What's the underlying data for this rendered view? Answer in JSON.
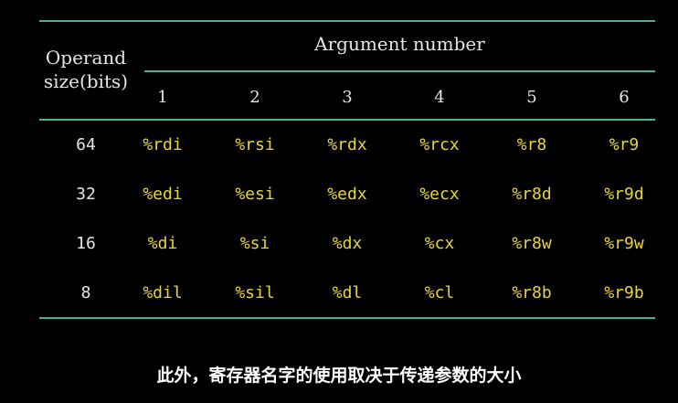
{
  "table": {
    "operand_header_line1": "Operand",
    "operand_header_line2": "size(bits)",
    "argument_header": "Argument number",
    "columns": [
      "1",
      "2",
      "3",
      "4",
      "5",
      "6"
    ],
    "rows": [
      {
        "size": "64",
        "regs": [
          "%rdi",
          "%rsi",
          "%rdx",
          "%rcx",
          "%r8",
          "%r9"
        ]
      },
      {
        "size": "32",
        "regs": [
          "%edi",
          "%esi",
          "%edx",
          "%ecx",
          "%r8d",
          "%r9d"
        ]
      },
      {
        "size": "16",
        "regs": [
          "%di",
          "%si",
          "%dx",
          "%cx",
          "%r8w",
          "%r9w"
        ]
      },
      {
        "size": "8",
        "regs": [
          "%dil",
          "%sil",
          "%dl",
          "%cl",
          "%r8b",
          "%r9b"
        ]
      }
    ]
  },
  "caption": "此外，寄存器名字的使用取决于传递参数的大小",
  "colors": {
    "background": "#000000",
    "rule": "#3fb39c",
    "register_text": "#e8d53a",
    "header_text": "#e6e6e6"
  }
}
